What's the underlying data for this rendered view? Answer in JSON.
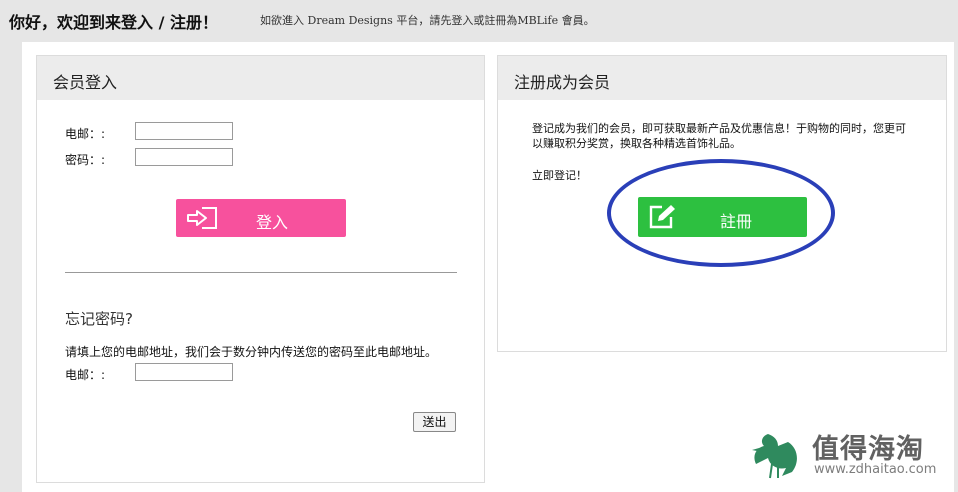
{
  "header": {
    "greeting": "你好，欢迎到来登入 / 注册！",
    "subtitle": "如欲進入 Dream Designs 平台，請先登入或註冊為MBLife 會員。"
  },
  "login": {
    "title": "会员登入",
    "email_label": "电邮：:",
    "email_value": "",
    "password_label": "密码：:",
    "password_value": "",
    "login_button": "登入",
    "login_icon": "login-arrow-icon"
  },
  "forgot": {
    "title": "忘记密码?",
    "instruction": "请填上您的电邮地址，我们会于数分钟内传送您的密码至此电邮地址。",
    "email_label": "电邮：:",
    "email_value": "",
    "send_button": "送出"
  },
  "register": {
    "title": "注册成为会员",
    "text": "登记成为我们的会员，即可获取最新产品及优惠信息！于购物的同时，您更可以赚取积分奖赏，换取各种精选首饰礼品。",
    "register_now": "立即登记！",
    "register_button": "註冊",
    "register_icon": "edit-pencil-icon"
  },
  "watermark": {
    "name": "值得海淘",
    "url": "www.zdhaitao.com",
    "icon": "bird-logo-icon"
  },
  "colors": {
    "login_button": "#f7519d",
    "register_button": "#2dc040",
    "highlight_circle": "#2a3fb8",
    "header_bg": "#e6e6e6"
  }
}
